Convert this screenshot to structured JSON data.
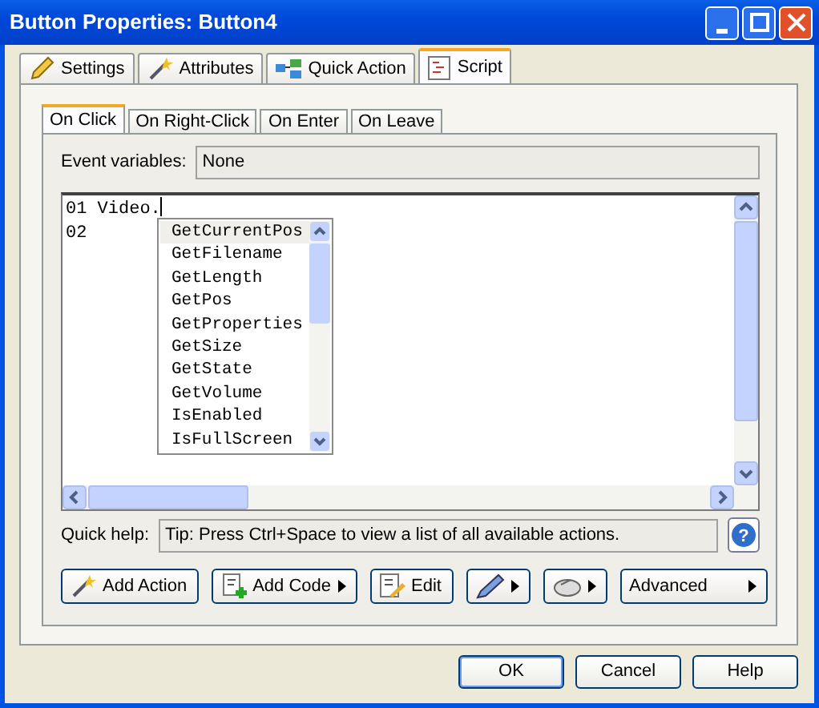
{
  "window": {
    "title": "Button Properties: Button4"
  },
  "tabs": [
    {
      "label": "Settings",
      "selected": false
    },
    {
      "label": "Attributes",
      "selected": false
    },
    {
      "label": "Quick Action",
      "selected": false
    },
    {
      "label": "Script",
      "selected": true
    }
  ],
  "event_tabs": [
    {
      "label": "On Click",
      "selected": true
    },
    {
      "label": "On Right-Click",
      "selected": false
    },
    {
      "label": "On Enter",
      "selected": false
    },
    {
      "label": "On Leave",
      "selected": false
    }
  ],
  "event_variables": {
    "label": "Event variables:",
    "value": "None"
  },
  "editor": {
    "lines": [
      {
        "number": "01",
        "text": "Video."
      },
      {
        "number": "02"
      }
    ],
    "autocomplete": [
      {
        "label": "GetCurrentPos",
        "selected": true
      },
      {
        "label": "GetFilename",
        "selected": false
      },
      {
        "label": "GetLength",
        "selected": false
      },
      {
        "label": "GetPos",
        "selected": false
      },
      {
        "label": "GetProperties",
        "selected": false
      },
      {
        "label": "GetSize",
        "selected": false
      },
      {
        "label": "GetState",
        "selected": false
      },
      {
        "label": "GetVolume",
        "selected": false
      },
      {
        "label": "IsEnabled",
        "selected": false
      },
      {
        "label": "IsFullScreen",
        "selected": false
      }
    ]
  },
  "quick_help": {
    "label": "Quick help:",
    "value": "Tip: Press Ctrl+Space to view a list of all available actions."
  },
  "help_button": {
    "label": "?"
  },
  "toolbar": [
    {
      "label": "Add Action",
      "menu": false
    },
    {
      "label": "Add Code",
      "menu": true
    },
    {
      "label": "Edit",
      "menu": false
    },
    {
      "menu": true
    },
    {
      "menu": true
    },
    {
      "label": "Advanced",
      "menu": true
    }
  ],
  "buttons": [
    {
      "label": "OK",
      "default": true
    },
    {
      "label": "Cancel",
      "default": false
    },
    {
      "label": "Help",
      "default": false
    }
  ]
}
